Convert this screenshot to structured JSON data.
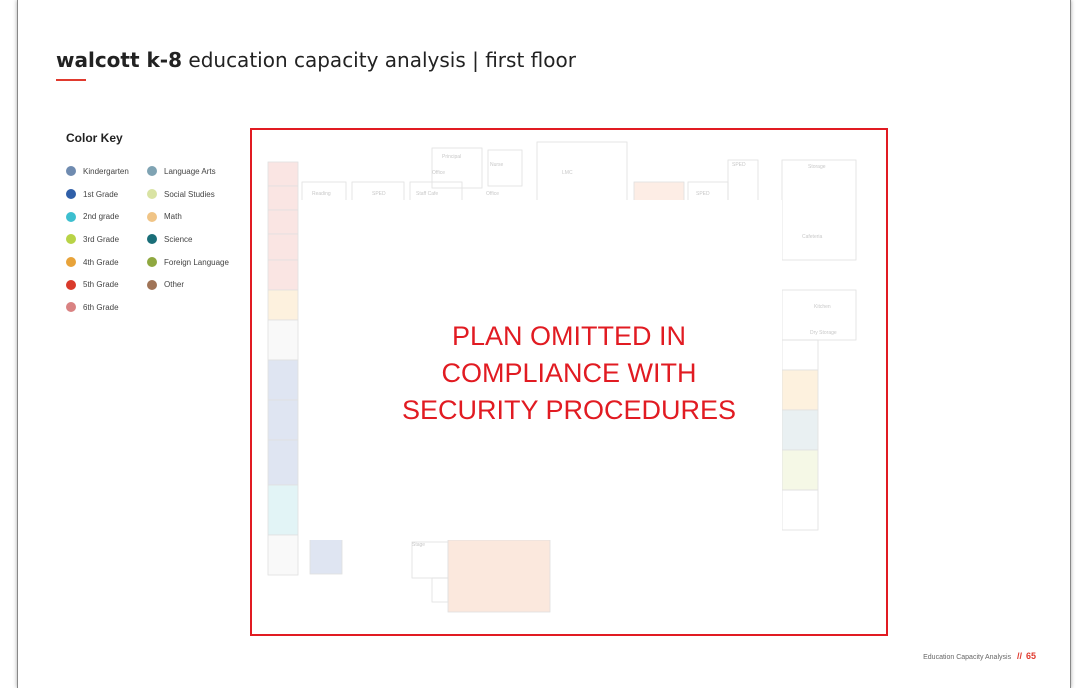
{
  "header": {
    "title_bold": "walcott k-8",
    "title_rest": " education capacity analysis | first floor"
  },
  "color_key": {
    "title": "Color Key",
    "column_1": [
      {
        "label": "Kindergarten",
        "color": "#6f8bb0"
      },
      {
        "label": "1st Grade",
        "color": "#2f5fa8"
      },
      {
        "label": "2nd grade",
        "color": "#3dbfcf"
      },
      {
        "label": "3rd Grade",
        "color": "#b8d347"
      },
      {
        "label": "4th Grade",
        "color": "#e8a33a"
      },
      {
        "label": "5th Grade",
        "color": "#d93a2b"
      },
      {
        "label": "6th Grade",
        "color": "#d98282"
      }
    ],
    "column_2": [
      {
        "label": "Language Arts",
        "color": "#7fa3b3"
      },
      {
        "label": "Social Studies",
        "color": "#d9e3a3"
      },
      {
        "label": "Math",
        "color": "#f0c486"
      },
      {
        "label": "Science",
        "color": "#1a6e78"
      },
      {
        "label": "Foreign Language",
        "color": "#8fa840"
      },
      {
        "label": "Other",
        "color": "#a07457"
      }
    ]
  },
  "plan": {
    "notice_lines": [
      "PLAN OMITTED IN",
      "COMPLIANCE WITH",
      "SECURITY PROCEDURES"
    ],
    "notice_color": "#e11b22",
    "faint_labels": {
      "reading": "Reading",
      "sped": "SPED",
      "staff_cafe": "Staff Cafe",
      "office": "Office",
      "lmc": "LMC",
      "cafeteria": "Cafeteria",
      "kitchen": "Kitchen",
      "dry_storage": "Dry Storage",
      "stage": "Stage",
      "storage": "Storage",
      "nurse": "Nurse",
      "principal": "Principal"
    }
  },
  "footer": {
    "label": "Education Capacity Analysis",
    "slashes": "//",
    "page": "65"
  },
  "colors": {
    "accent": "#e03a2e",
    "frame_red": "#e11b22"
  }
}
